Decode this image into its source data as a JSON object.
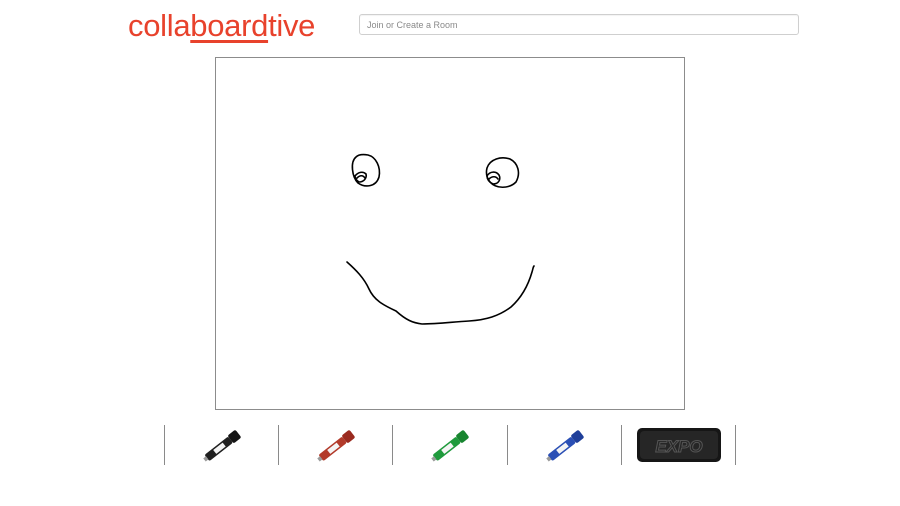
{
  "header": {
    "logo": {
      "part1": "colla",
      "part2": "board",
      "part3": "tive"
    },
    "search": {
      "placeholder": "Join or Create a Room",
      "value": ""
    }
  },
  "tools": [
    {
      "id": "black-marker",
      "kind": "marker",
      "color": "#1f1f1f"
    },
    {
      "id": "red-marker",
      "kind": "marker",
      "color": "#b23a2a"
    },
    {
      "id": "green-marker",
      "kind": "marker",
      "color": "#1f9a3c"
    },
    {
      "id": "blue-marker",
      "kind": "marker",
      "color": "#2a4fb5"
    },
    {
      "id": "eraser",
      "kind": "eraser",
      "brand": "EXPO"
    }
  ],
  "colors": {
    "brand": "#e8422c",
    "board_border": "#8c8c8c",
    "stroke": "#000000"
  }
}
